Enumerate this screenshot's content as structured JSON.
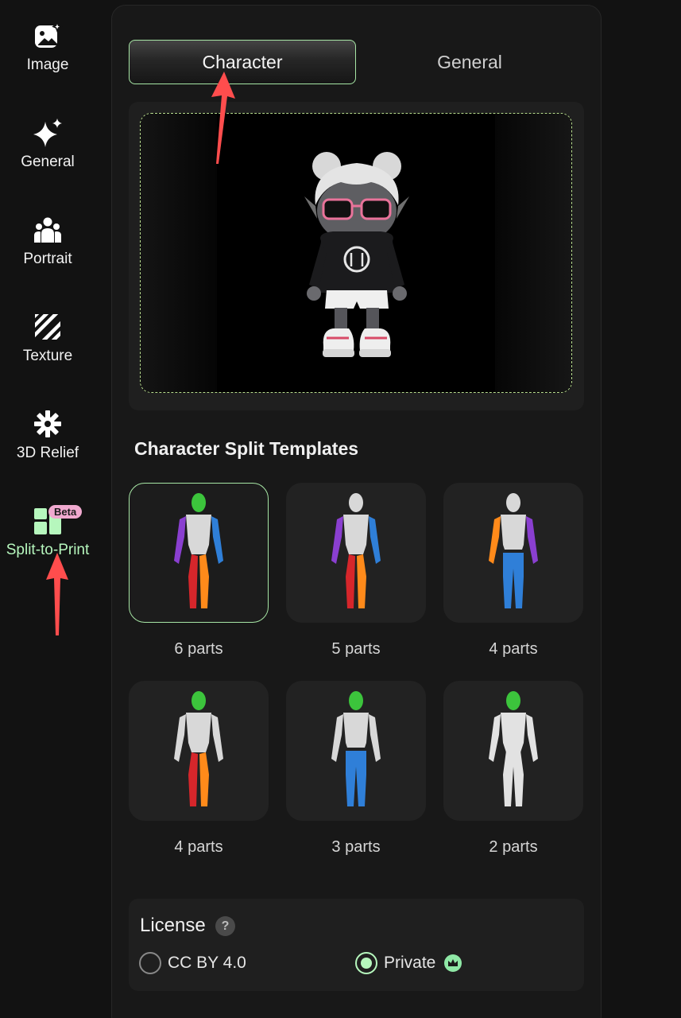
{
  "sidebar": {
    "items": [
      {
        "label": "Image",
        "icon": "image-sparkle-icon"
      },
      {
        "label": "General",
        "icon": "sparkle-icon"
      },
      {
        "label": "Portrait",
        "icon": "people-icon"
      },
      {
        "label": "Texture",
        "icon": "texture-stripes-icon"
      },
      {
        "label": "3D Relief",
        "icon": "relief-gear-icon"
      },
      {
        "label": "Split-to-Print",
        "icon": "split-blocks-icon",
        "badge": "Beta",
        "active": true
      }
    ]
  },
  "tabs": [
    {
      "label": "Character",
      "active": true
    },
    {
      "label": "General",
      "active": false
    }
  ],
  "templates": {
    "title": "Character Split Templates",
    "items": [
      {
        "label": "6 parts",
        "selected": true
      },
      {
        "label": "5 parts",
        "selected": false
      },
      {
        "label": "4 parts",
        "selected": false
      },
      {
        "label": "4 parts",
        "selected": false
      },
      {
        "label": "3 parts",
        "selected": false
      },
      {
        "label": "2 parts",
        "selected": false
      }
    ]
  },
  "license": {
    "title": "License",
    "help": "?",
    "options": [
      {
        "label": "CC BY 4.0",
        "selected": false
      },
      {
        "label": "Private",
        "selected": true,
        "icon": "crown-icon"
      }
    ]
  },
  "colors": {
    "accent": "#b6f7bd",
    "arrow": "#ff4d4d",
    "beta_badge": "#f0a9cf",
    "part_green": "#3cc43c",
    "part_purple": "#8a3fd0",
    "part_blue": "#2f7fd8",
    "part_red": "#d6262b",
    "part_orange": "#ff8a1a"
  }
}
